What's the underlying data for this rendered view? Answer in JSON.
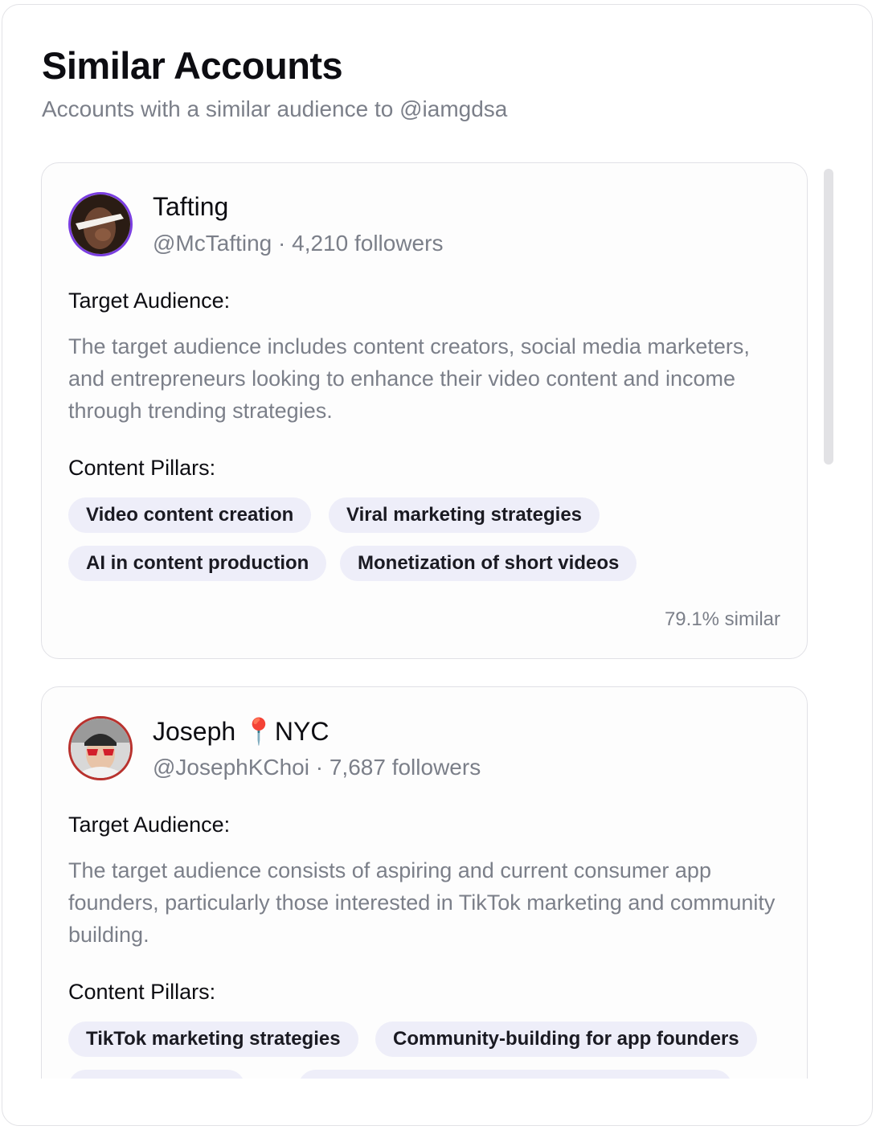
{
  "header": {
    "title": "Similar Accounts",
    "subtitle": "Accounts with a similar audience to @iamgdsa"
  },
  "accounts": [
    {
      "name": "Tafting",
      "handle_line": "@McTafting · 4,210 followers",
      "audience_label": "Target Audience:",
      "audience_text": "The target audience includes content creators, social media marketers, and entrepreneurs looking to enhance their video content and income through trending strategies.",
      "pillars_label": "Content Pillars:",
      "pillars": [
        "Video content creation",
        "Viral marketing strategies",
        "AI in content production",
        "Monetization of short videos"
      ],
      "similarity": "79.1% similar",
      "avatar_ring_color": "#7a3ee0"
    },
    {
      "name": "Joseph 📍NYC",
      "handle_line": "@JosephKChoi · 7,687 followers",
      "audience_label": "Target Audience:",
      "audience_text": "The target audience consists of aspiring and current consumer app founders, particularly those interested in TikTok marketing and community building.",
      "pillars_label": "Content Pillars:",
      "pillars": [
        "TikTok marketing strategies",
        "Community-building for app founders"
      ],
      "avatar_ring_color": "#b8322e"
    }
  ]
}
